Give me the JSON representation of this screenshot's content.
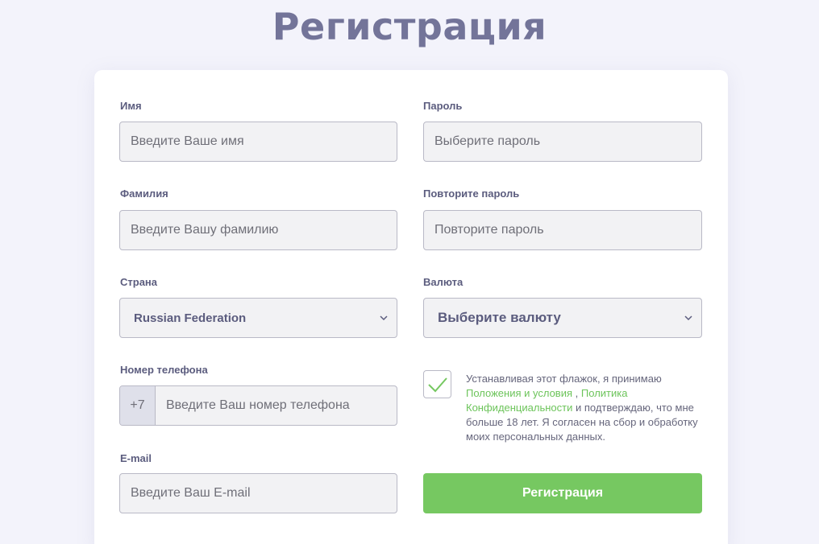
{
  "page": {
    "title": "Регистрация"
  },
  "form": {
    "first_name": {
      "label": "Имя",
      "placeholder": "Введите Ваше имя"
    },
    "last_name": {
      "label": "Фамилия",
      "placeholder": "Введите Вашу фамилию"
    },
    "country": {
      "label": "Страна",
      "selected": "Russian Federation"
    },
    "phone": {
      "label": "Номер телефона",
      "prefix": "+7",
      "placeholder": "Введите Ваш номер телефона"
    },
    "email": {
      "label": "E-mail",
      "placeholder": "Введите Ваш E-mail"
    },
    "password": {
      "label": "Пароль",
      "placeholder": "Выберите пароль"
    },
    "password_repeat": {
      "label": "Повторите пароль",
      "placeholder": "Повторите пароль"
    },
    "currency": {
      "label": "Валюта",
      "selected": "Выберите валюту"
    },
    "consent": {
      "checked": true,
      "text_before": "Устанавливая этот флажок, я принимаю",
      "link_terms": "Положения и условия",
      "separator": ",",
      "link_privacy": "Политика Конфиденциальности",
      "text_after": "и подтверждаю, что мне больше 18 лет. Я согласен на сбор и обработку моих персональных данных."
    },
    "submit_label": "Регистрация"
  },
  "colors": {
    "title": "#737499",
    "accent_green": "#76c861",
    "link_green": "#6cc45a",
    "label": "#5b5c7e"
  },
  "icons": {
    "select_arrow": "chevron-down-icon",
    "consent_check": "checkmark-icon"
  }
}
